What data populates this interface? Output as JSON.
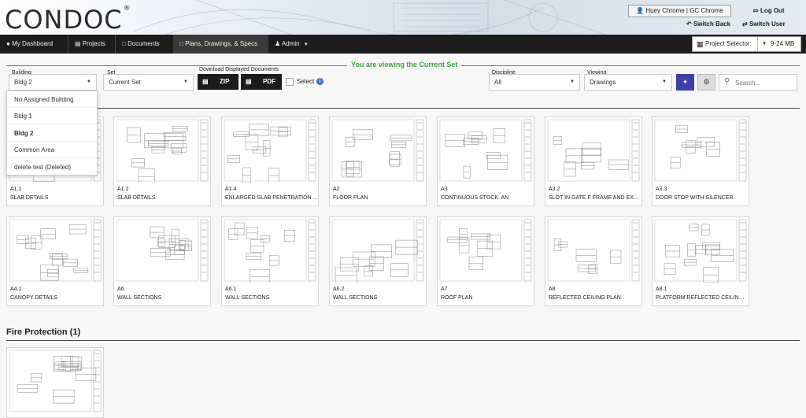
{
  "brand": {
    "logo": "CONDOC"
  },
  "header": {
    "user": "Huey Chrome | GC Chrome",
    "log_out": "Log Out",
    "switch_back": "Switch Back",
    "switch_user": "Switch User"
  },
  "nav": {
    "items": [
      {
        "label": "My Dashboard",
        "icon": "dashboard-icon"
      },
      {
        "label": "Projects",
        "icon": "projects-icon"
      },
      {
        "label": "Documents",
        "icon": "documents-icon"
      },
      {
        "label": "Plans, Drawings, & Specs",
        "icon": "plans-icon"
      },
      {
        "label": "Admin",
        "icon": "admin-icon"
      }
    ],
    "project_selector_label": "Project Selector:",
    "project_selector_value": "9-24 MB"
  },
  "banner": "You are viewing the Current Set",
  "filters": {
    "building_label": "Building",
    "building_value": "Bldg 2",
    "set_label": "Set",
    "set_value": "Current Set",
    "download_label": "Download Displayed Documents",
    "zip": "ZIP",
    "pdf": "PDF",
    "select": "Select",
    "discipline_label": "Discipline",
    "discipline_value": "All",
    "viewing_label": "Viewing",
    "viewing_value": "Drawings",
    "search_placeholder": "Search..."
  },
  "building_options": [
    "No Assigned Building",
    "Bldg 1",
    "Bldg 2",
    "Common Area",
    "delete test (Deleted)"
  ],
  "cards_row1": [
    {
      "code": "A1.1",
      "title": "SLAB DETAILS"
    },
    {
      "code": "A1.2",
      "title": "SLAB DETAILS"
    },
    {
      "code": "A1.4",
      "title": "ENLARGED SLAB PENETRATION ..."
    },
    {
      "code": "A2",
      "title": "FLOOR PLAN"
    },
    {
      "code": "A3",
      "title": "CONTINUOUS STOCK. AN"
    },
    {
      "code": "A3.2",
      "title": "SLOT IN GATE F FRAME AND EXPA..."
    },
    {
      "code": "A3.3",
      "title": "DOOR STOP WITH SILENCER"
    }
  ],
  "cards_row2": [
    {
      "code": "A4.1",
      "title": "CANOPY DETAILS"
    },
    {
      "code": "A6",
      "title": "WALL SECTIONS"
    },
    {
      "code": "A6.1",
      "title": "WALL SECTIONS"
    },
    {
      "code": "A6.2",
      "title": "WALL SECTIONS"
    },
    {
      "code": "A7",
      "title": "ROOF PLAN"
    },
    {
      "code": "A8",
      "title": "REFLECTED CEILING PLAN"
    },
    {
      "code": "A8.1",
      "title": "PLATFORM REFLECTED CEILING ..."
    }
  ],
  "fire_section": "Fire Protection (1)",
  "colors": {
    "accent_green": "#3aa63a",
    "nav_bg": "#1c1c1c",
    "primary_btn": "#3f3fa8"
  }
}
